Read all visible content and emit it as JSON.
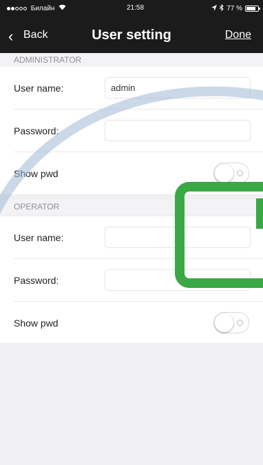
{
  "status_bar": {
    "carrier": "Билайн",
    "time": "21:58",
    "battery": "77 %"
  },
  "nav": {
    "back_label": "Back",
    "title": "User setting",
    "done_label": "Done"
  },
  "administrator": {
    "header": "ADMINISTRATOR",
    "username_label": "User name:",
    "username_value": "admin",
    "password_label": "Password:",
    "password_value": "",
    "show_pwd_label": "Show pwd"
  },
  "operator": {
    "header": "OPERATOR",
    "username_label": "User name:",
    "username_value": "",
    "password_label": "Password:",
    "password_value": "",
    "show_pwd_label": "Show pwd"
  },
  "icons": {
    "wifi": "wifi-icon",
    "location": "location-icon",
    "bluetooth": "bluetooth-icon",
    "battery": "battery-icon",
    "back": "chevron-left-icon"
  },
  "colors": {
    "bar": "#1b1b1b",
    "overlay_box": "#3aa845",
    "overlay_arc": "#9fb8d6"
  }
}
